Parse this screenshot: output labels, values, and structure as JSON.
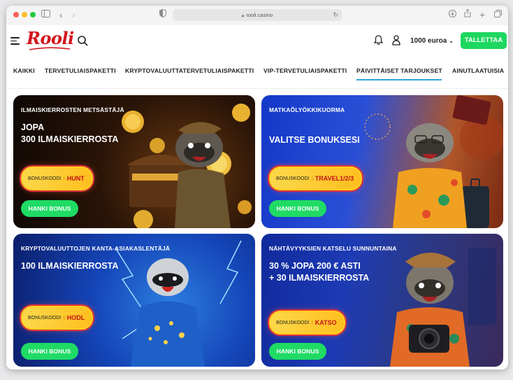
{
  "browser": {
    "url": "rooli.casino"
  },
  "header": {
    "logo": "Rooli",
    "balance": "1000 euroa",
    "deposit_label": "TALLETTAA"
  },
  "tabs": [
    {
      "label": "KAIKKI"
    },
    {
      "label": "TERVETULIAISPAKETTI"
    },
    {
      "label": "KRYPTOVALUUTTATERVETULIAISPAKETTI"
    },
    {
      "label": "VIP-TERVETULIAISPAKETTI"
    },
    {
      "label": "PÄIVITTÄISET TARJOUKSET",
      "active": true
    },
    {
      "label": "AINUTLAATUISIA"
    }
  ],
  "cards": [
    {
      "kicker": "ILMAISKIERROSTEN METSÄSTÄJÄ",
      "headline": "JOPA\n300 ILMAISKIERROSTA",
      "code_label": "BONUSKOODI",
      "code_sep": ":",
      "code": "HUNT",
      "cta": "HANKI BONUS"
    },
    {
      "kicker": "MATKAÕLYÖKKIKUORMA",
      "headline": "VALITSE BONUKSESI",
      "code_label": "BONUSKOODI",
      "code_sep": ":",
      "code": "TRAVEL1/2/3",
      "cta": "HANKI BONUS"
    },
    {
      "kicker": "KRYPTOVALUUTTOJEN KANTA-ASIAKASLENTÄJÄ",
      "headline": "100 ILMAISKIERROSTA",
      "code_label": "BONUSKOODI",
      "code_sep": ":",
      "code": "HODL",
      "cta": "HANKI BONUS"
    },
    {
      "kicker": "NÄHTÄVYYKSIEN KATSELU SUNNUNTAINA",
      "headline": "30 % JOPA 200 € ASTI\n+ 30 ILMAISKIERROSTA",
      "code_label": "BONUSKOODI",
      "code_sep": ":",
      "code": "KATSO",
      "cta": "HANKI BONUS"
    }
  ],
  "colors": {
    "brand": "#d3151e",
    "deposit": "#1ed760",
    "tab_active": "#2fa4d9",
    "cta": "#1fdb64",
    "code_value": "#c31218"
  }
}
